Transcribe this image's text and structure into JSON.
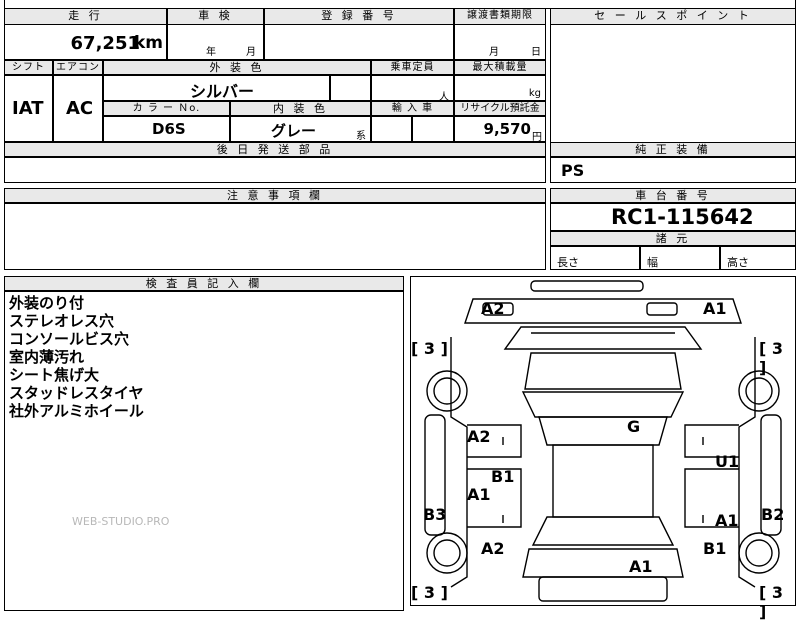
{
  "labels": {
    "mileage": "走 行",
    "inspection": "車 検",
    "registration": "登 録 番 号",
    "transfer": "譲渡書類期限",
    "sales_point": "セ ー ル ス ポ イ ン ト",
    "shift": "シフト",
    "ac": "エアコン",
    "exterior_color": "外 装 色",
    "capacity": "乗車定員",
    "max_load": "最大積載量",
    "color_no": "カ ラ ー Ｎo.",
    "interior_color": "内 装 色",
    "import": "輸 入 車",
    "recycle": "リサイクル預託金",
    "later_parts": "後 日 発 送 部 品",
    "equipment": "純 正 装 備",
    "notes": "注 意 事 項 欄",
    "chassis": "車 台 番 号",
    "dims": "諸 元",
    "inspector": "検 査 員 記 入 欄",
    "length": "長さ",
    "width": "幅",
    "height": "高さ"
  },
  "units": {
    "km": "km",
    "year": "年",
    "month": "月",
    "person": "人",
    "kg": "kg",
    "yen": "円",
    "family": "系",
    "month2": "月",
    "day": "日"
  },
  "values": {
    "mileage": "67,251",
    "shift": "IAT",
    "ac": "AC",
    "exterior_color": "シルバー",
    "color_no": "D6S",
    "interior_color": "グレー",
    "recycle": "9,570",
    "equipment": "PS",
    "chassis": "RC1-115642"
  },
  "inspector_notes": [
    "外装のり付",
    "ステレオレス穴",
    "コンソールビス穴",
    "室内薄汚れ",
    "シート焦げ大",
    "スタッドレスタイヤ",
    "社外アルミホイール"
  ],
  "diagram_marks": {
    "front_left": "A2",
    "front_right": "A1",
    "tire_fl": "[ 3 ]",
    "tire_fr": "[ 3 ]",
    "tire_rl": "[ 3 ]",
    "tire_rr": "[ 3 ]",
    "roof": "G",
    "left_front_door": "A2",
    "left_pillar": "B1",
    "left_rear_door": "A1",
    "left_sill": "B3",
    "right_front_door": "U1",
    "right_rear_door": "A1",
    "right_sill": "B2",
    "left_rear_fender": "A2",
    "right_rear_fender": "B1",
    "rear": "A1"
  },
  "watermark": "WEB-STUDIO.PRO"
}
